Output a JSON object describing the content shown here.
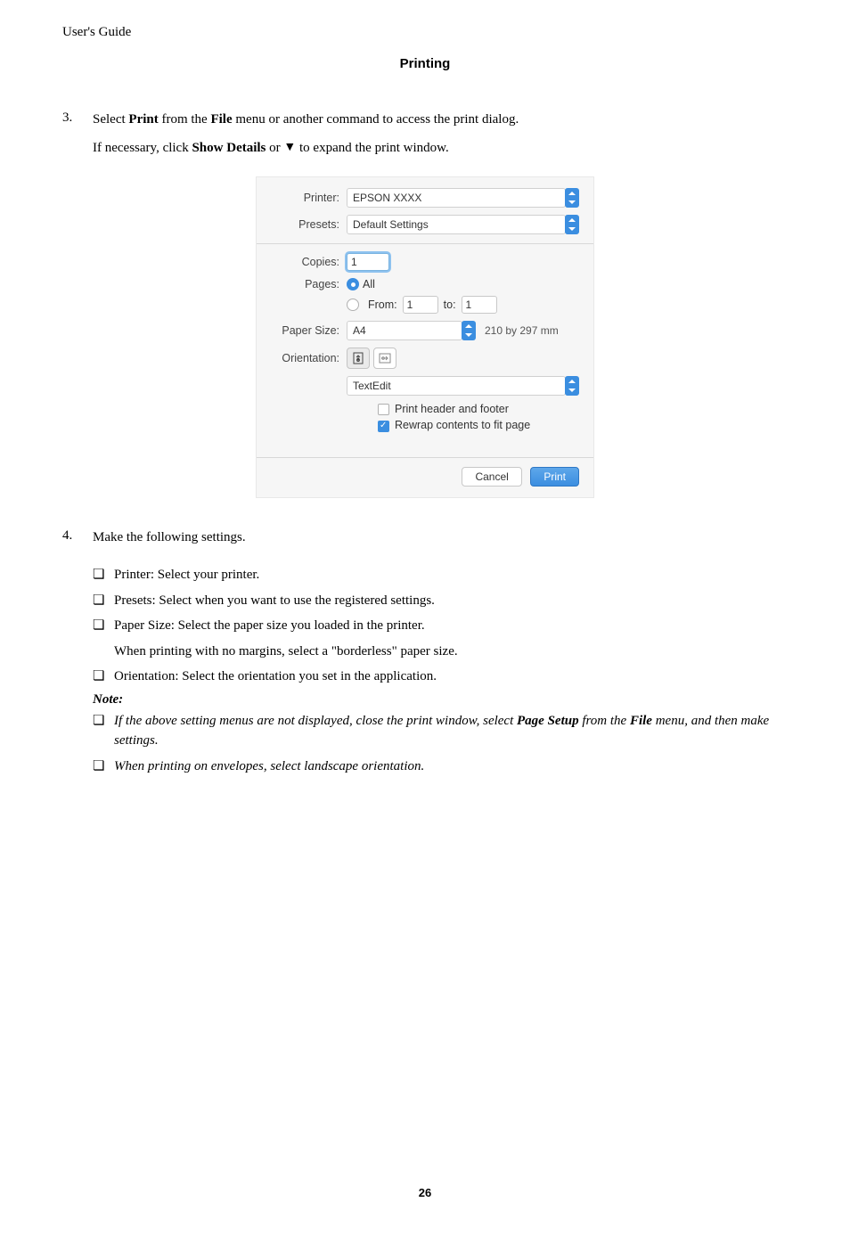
{
  "header": {
    "doc_title": "User's Guide",
    "section": "Printing"
  },
  "step3": {
    "num": "3.",
    "line1_a": "Select ",
    "line1_b": "Print",
    "line1_c": " from the ",
    "line1_d": "File",
    "line1_e": " menu or another command to access the print dialog.",
    "line2_a": "If necessary, click ",
    "line2_b": "Show Details",
    "line2_c": " or ",
    "line2_d": " to expand the print window."
  },
  "dialog": {
    "printer_label": "Printer:",
    "printer_value": "EPSON XXXX",
    "presets_label": "Presets:",
    "presets_value": "Default Settings",
    "copies_label": "Copies:",
    "copies_value": "1",
    "pages_label": "Pages:",
    "pages_all": "All",
    "pages_from": "From:",
    "pages_from_val": "1",
    "pages_to": "to:",
    "pages_to_val": "1",
    "papersize_label": "Paper Size:",
    "papersize_value": "A4",
    "papersize_dims": "210 by 297 mm",
    "orientation_label": "Orientation:",
    "panel_select": "TextEdit",
    "cb1": "Print header and footer",
    "cb2": "Rewrap contents to fit page",
    "cancel": "Cancel",
    "print": "Print"
  },
  "step4": {
    "num": "4.",
    "intro": "Make the following settings.",
    "b1": "Printer: Select your printer.",
    "b2": "Presets: Select when you want to use the registered settings.",
    "b3": "Paper Size: Select the paper size you loaded in the printer.",
    "b3_sub": "When printing with no margins, select a \"borderless\" paper size.",
    "b4": "Orientation: Select the orientation you set in the application.",
    "note_head": "Note:",
    "n1_a": "If the above setting menus are not displayed, close the print window, select ",
    "n1_b": "Page Setup",
    "n1_c": " from the ",
    "n1_d": "File",
    "n1_e": " menu, and then make settings.",
    "n2": "When printing on envelopes, select landscape orientation."
  },
  "page_number": "26"
}
